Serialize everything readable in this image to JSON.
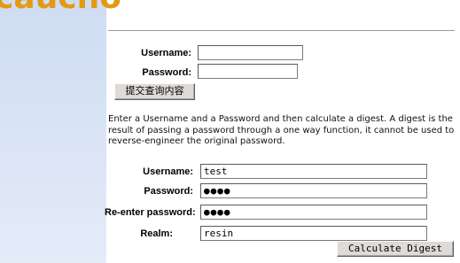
{
  "brand": {
    "logo_text": "caucho",
    "accent_color": "#e39a12"
  },
  "login_form": {
    "username_label": "Username:",
    "username_value": "",
    "password_label": "Password:",
    "password_value": "",
    "submit_label": "提交查询内容"
  },
  "description": "Enter a Username and a Password and then calculate a digest. A digest is the result of passing a password through a one way function, it cannot be used to reverse-engineer the original password.",
  "digest_form": {
    "username_label": "Username:",
    "username_value": "test",
    "password_label": "Password:",
    "password_mask": "●●●●",
    "reenter_label": "Re-enter password:",
    "reenter_mask": "●●●●",
    "realm_label": "Realm:",
    "realm_value": "resin",
    "calculate_label": "Calculate Digest"
  }
}
